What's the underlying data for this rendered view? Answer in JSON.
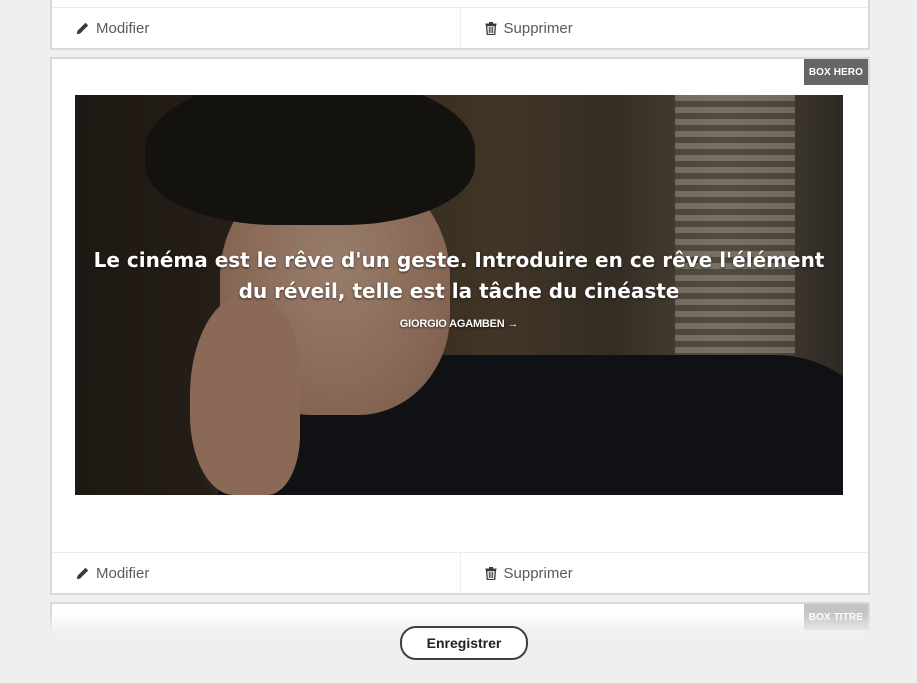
{
  "cards": {
    "top": {
      "edit_label": "Modifier",
      "delete_label": "Supprimer"
    },
    "hero": {
      "badge": "BOX HERO",
      "quote": "Le cinéma est le rêve d'un geste. Introduire en ce rêve l'élément du réveil, telle est la tâche du cinéaste",
      "author": "GIORGIO AGAMBEN →",
      "edit_label": "Modifier",
      "delete_label": "Supprimer"
    },
    "next": {
      "badge": "BOX TITRE"
    }
  },
  "footer": {
    "save_label": "Enregistrer"
  },
  "icons": {
    "edit": "pencil-icon",
    "delete": "trash-icon"
  },
  "colors": {
    "page_background": "#efefed",
    "badge_background": "#666666",
    "button_border": "#3b4148"
  }
}
